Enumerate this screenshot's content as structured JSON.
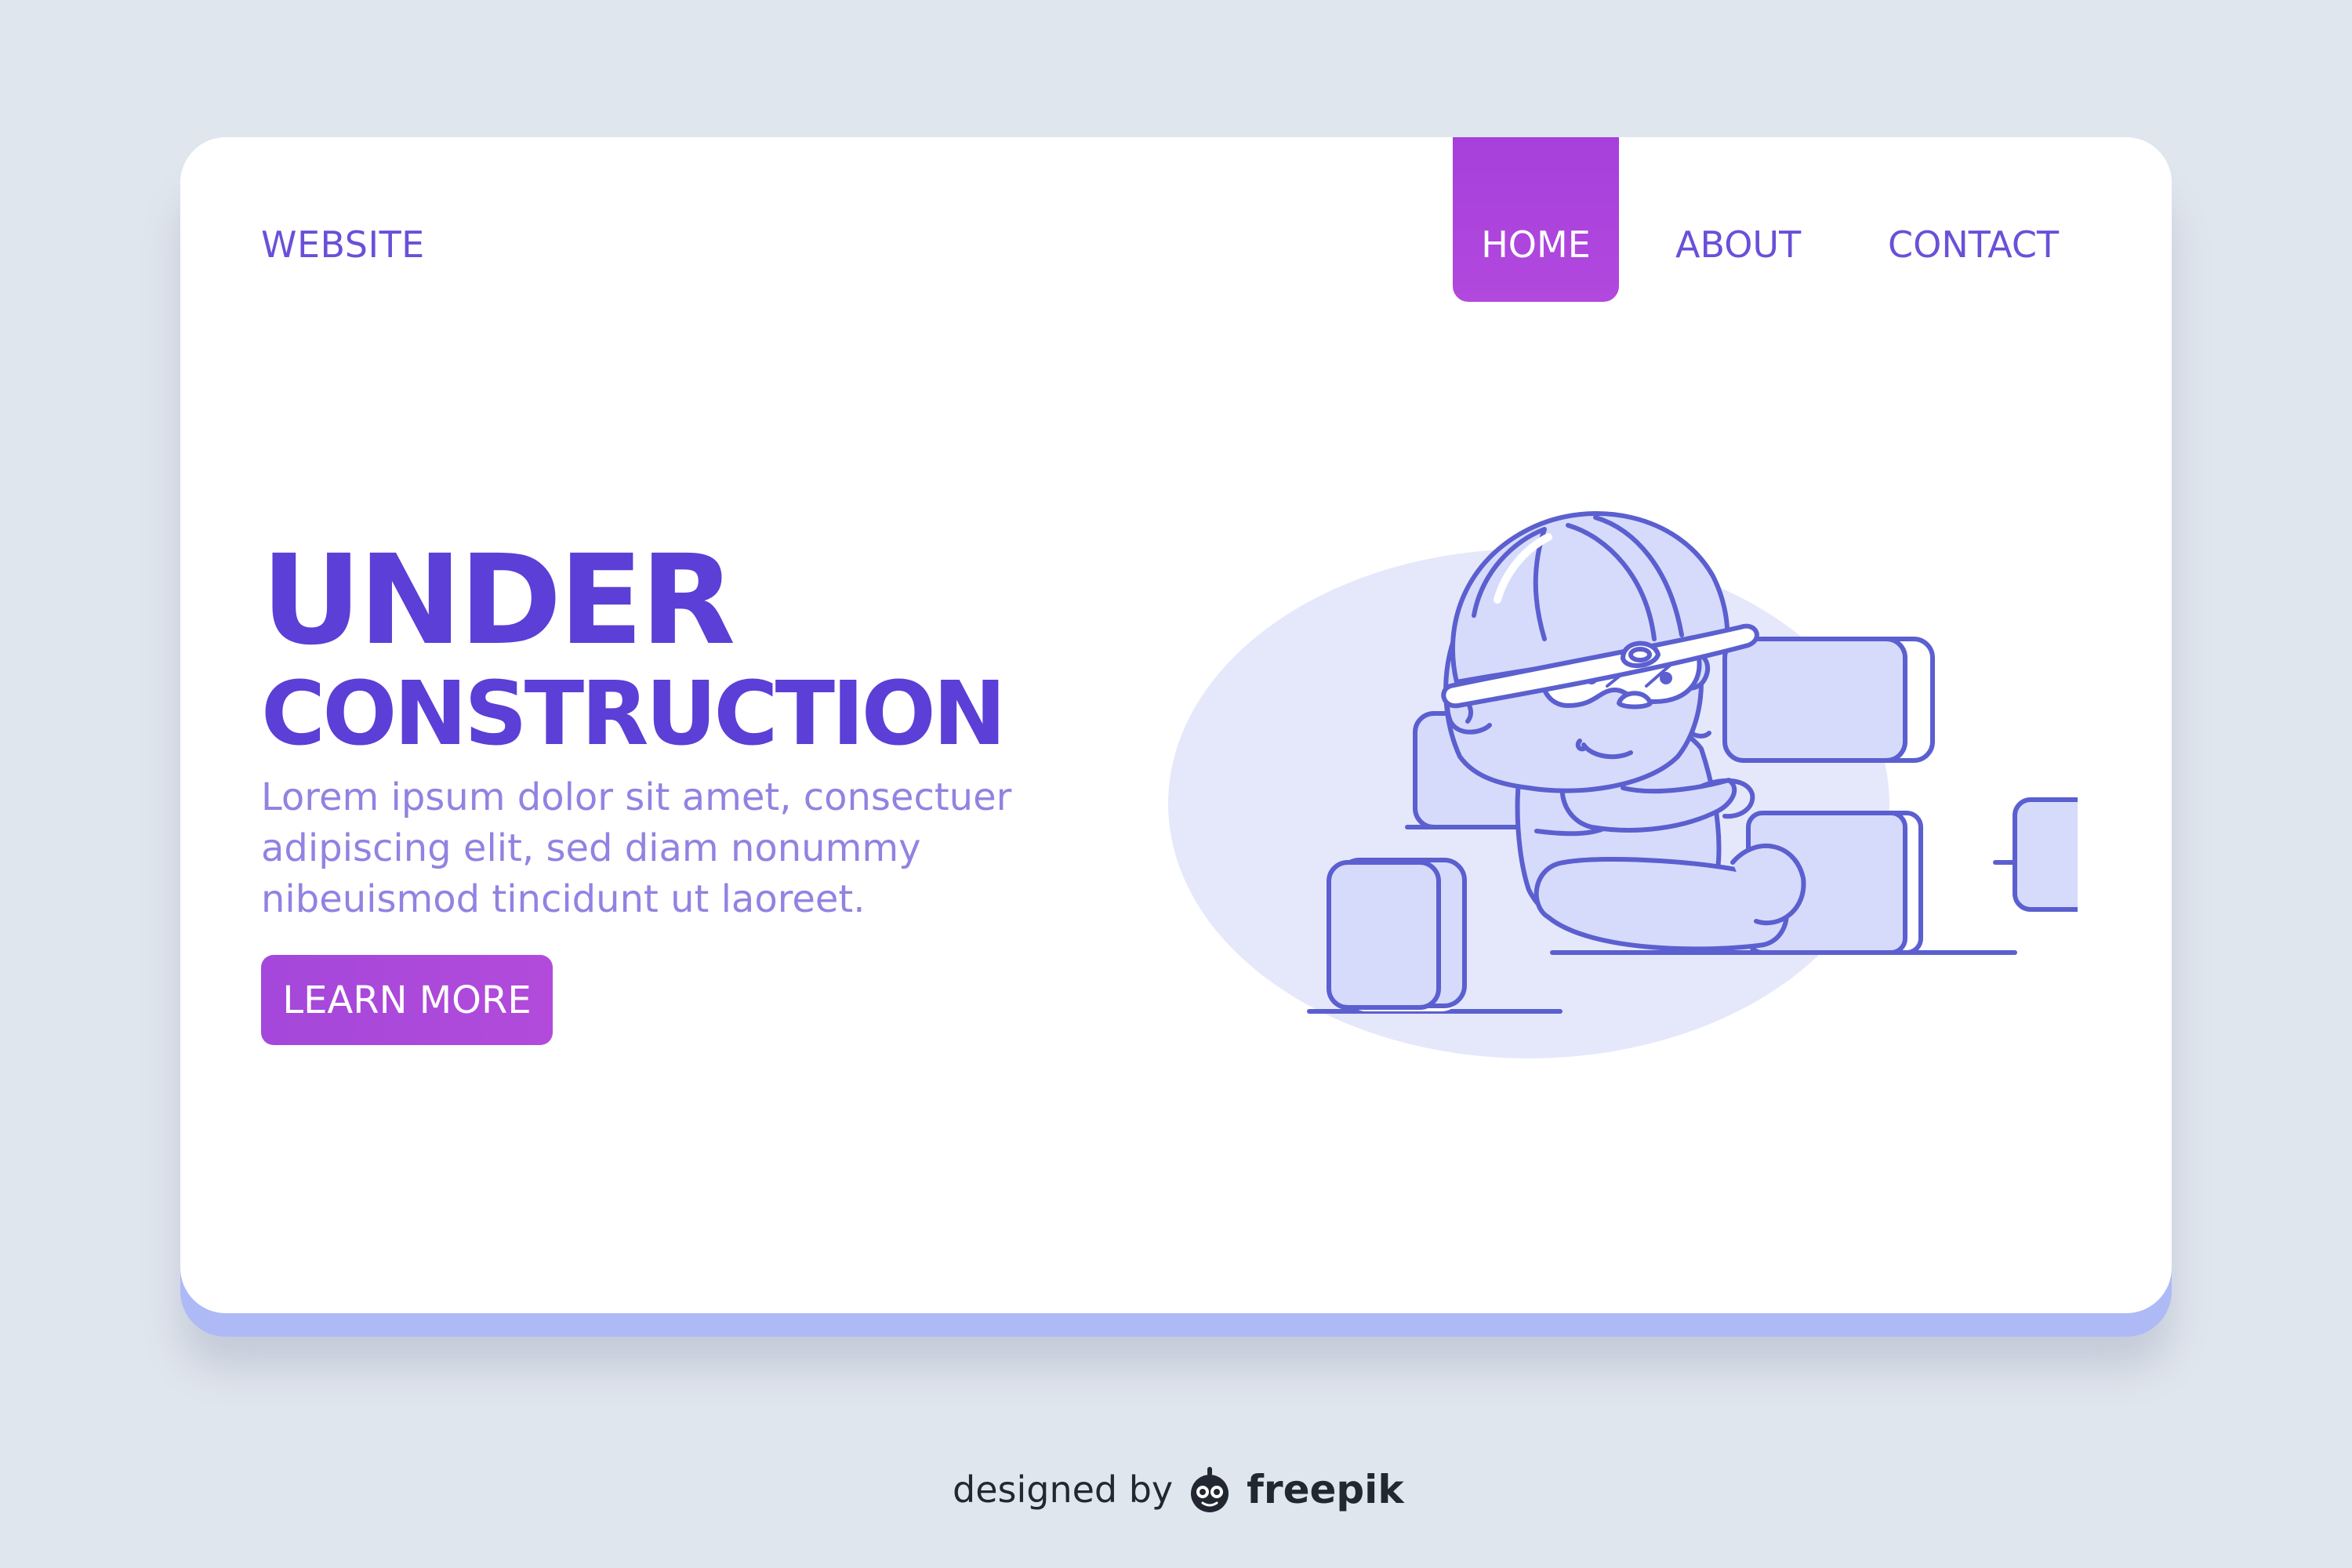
{
  "header": {
    "brand": "WEBSITE",
    "nav": [
      {
        "label": "HOME",
        "active": true
      },
      {
        "label": "ABOUT",
        "active": false
      },
      {
        "label": "CONTACT",
        "active": false
      }
    ]
  },
  "hero": {
    "title_line1": "UNDER",
    "title_line2": "CONSTRUCTION",
    "body_lines": [
      "Lorem ipsum dolor sit amet, consectuer",
      "adipiscing elit, sed diam nonummy",
      "nibeuismod tincidunt ut laoreet."
    ],
    "cta_label": "LEARN MORE"
  },
  "illustration": {
    "subject": "baby-construction-worker-with-blocks"
  },
  "footer": {
    "credit_prefix": "designed by",
    "credit_brand": "freepik",
    "credit_icon": "freepik-logo-icon"
  },
  "colors": {
    "background": "#e0e6ee",
    "card": "#ffffff",
    "card_base": "#aebaf6",
    "primary_text": "#5b3fd6",
    "nav_text": "#6a50d8",
    "body_text": "#9282e2",
    "accent": "#a63fdc",
    "illustration_stroke": "#5b5fcf",
    "illustration_fill": "#d6dbfb",
    "illustration_blob": "#e5e8fb"
  }
}
